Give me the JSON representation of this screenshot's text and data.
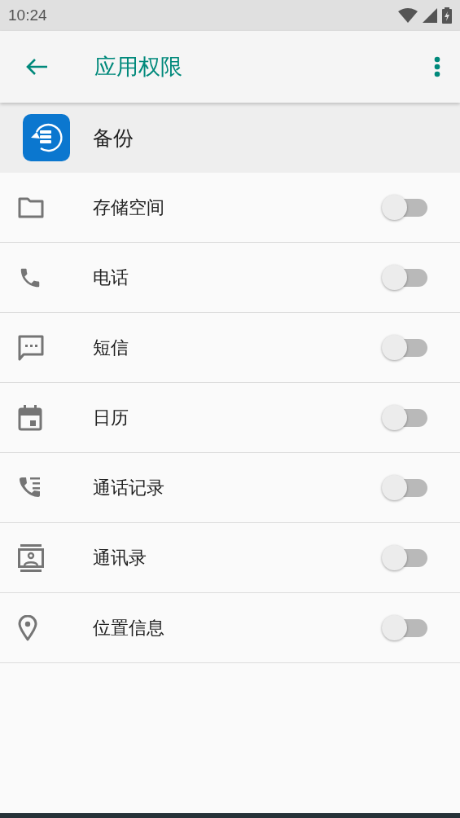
{
  "status_bar": {
    "time": "10:24"
  },
  "app_bar": {
    "title": "应用权限"
  },
  "app": {
    "name": "备份"
  },
  "permissions": [
    {
      "kind": "storage",
      "label": "存储空间",
      "on": false
    },
    {
      "kind": "phone",
      "label": "电话",
      "on": false
    },
    {
      "kind": "sms",
      "label": "短信",
      "on": false
    },
    {
      "kind": "calendar",
      "label": "日历",
      "on": false
    },
    {
      "kind": "call_log",
      "label": "通话记录",
      "on": false
    },
    {
      "kind": "contacts",
      "label": "通讯录",
      "on": false
    },
    {
      "kind": "location",
      "label": "位置信息",
      "on": false
    }
  ]
}
